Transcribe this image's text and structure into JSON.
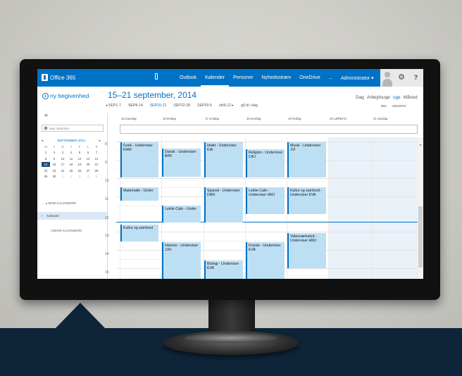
{
  "topbar": {
    "brand": "Office 365",
    "nav": [
      "Outlook",
      "Kalender",
      "Personer",
      "Nyhedsstrøm",
      "OneDrive",
      "..."
    ],
    "active_nav": "Kalender",
    "admin": "Administrator ▾",
    "gear_icon": "⚙",
    "help_icon": "?"
  },
  "header": {
    "new_event": "ny begivenhed",
    "new_event_icon": "+",
    "date_range": "15–21 september, 2014",
    "week_nav": [
      "◂ SEP1-7",
      "SEP8-14",
      "SEP15-21",
      "SEP22-28",
      "SEP29-5",
      "okt6-12 ▸",
      "gå til i dag"
    ],
    "active_week": "SEP15-21",
    "views": [
      "Dag",
      "Arbejdsuge",
      "uge",
      "Måned"
    ],
    "active_view": "uge",
    "share_label": "DEL",
    "print_label": "UDSKRIV",
    "collapse_icon": "«"
  },
  "sidebar": {
    "search_placeholder": "søg i kalender",
    "minical": {
      "month": "SEPTEMBER 2014",
      "prev": "◂",
      "next": "▸",
      "dow": [
        "M",
        "T",
        "O",
        "T",
        "F",
        "L",
        "S"
      ],
      "rows": [
        [
          "1",
          "2",
          "3",
          "4",
          "5",
          "6",
          "7"
        ],
        [
          "8",
          "9",
          "10",
          "11",
          "12",
          "13",
          "14"
        ],
        [
          "15",
          "16",
          "17",
          "18",
          "19",
          "20",
          "21"
        ],
        [
          "22",
          "23",
          "24",
          "25",
          "26",
          "27",
          "28"
        ],
        [
          "29",
          "30",
          "1",
          "2",
          "3",
          "4",
          "5"
        ]
      ],
      "selected": "15"
    },
    "my_calendars": "▴ MINE KALENDERE",
    "calendar_item": "Kalender",
    "check_icon": "✓",
    "other_calendars": "ANDRE KALENDERE"
  },
  "calendar": {
    "days": [
      "15 mandag",
      "16 tirsdag",
      "17 onsdag",
      "18 torsdag",
      "19 fredag",
      "20 LØRDAG",
      "21 søndag"
    ],
    "hours": [
      "8",
      "9",
      "10",
      "11",
      "12",
      "13",
      "14",
      "15"
    ],
    "events": [
      {
        "title": "Fysik - Underviser KHM"
      },
      {
        "title": "Dansk - Underviser BPK"
      },
      {
        "title": "Idræt - Underviser KIA"
      },
      {
        "title": "Religion - Underviser CAJ"
      },
      {
        "title": "Musik - Underviser JVI"
      },
      {
        "title": "Matematik - Under"
      },
      {
        "title": "Spansk - Underviser DAN"
      },
      {
        "title": "Lektie Cafe - Underviser HMJ"
      },
      {
        "title": "Kultur og samfund - Underviser EVA"
      },
      {
        "title": "Lektie Cafe - Under"
      },
      {
        "title": "Kultur og samfund"
      },
      {
        "title": "Videoværksted - Underviser HMJ"
      },
      {
        "title": "Historie - Underviser JJH"
      },
      {
        "title": "Fransk - Underviser EVA"
      },
      {
        "title": "Biologi - Underviser EVA"
      }
    ]
  }
}
